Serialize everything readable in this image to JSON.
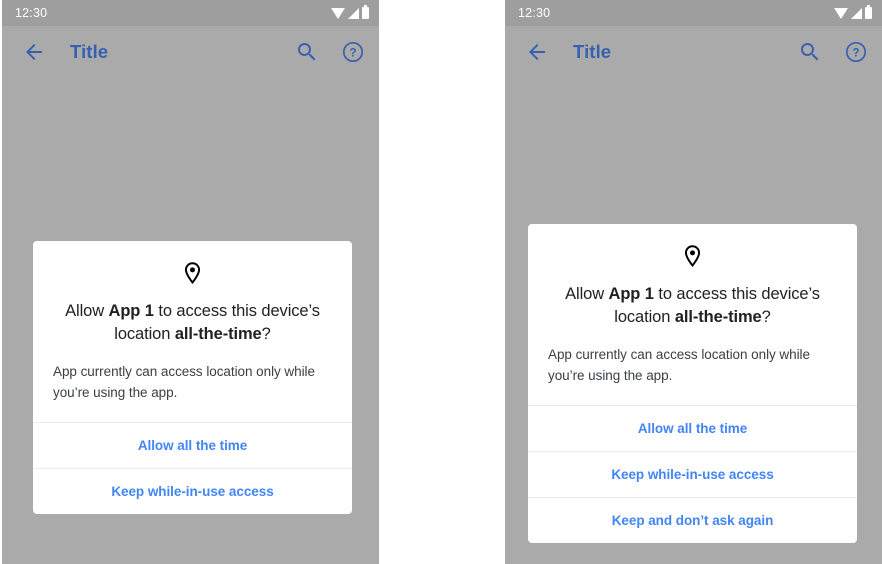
{
  "colors": {
    "screen_background": "#aaaaaa",
    "status_bar_background": "#9e9e9e",
    "toolbar_title": "#3860b0",
    "dialog_background": "#ffffff",
    "action_link": "#4285f4",
    "headline_text": "#202124",
    "body_text": "#3c4043",
    "divider": "#e8eaed"
  },
  "phones": [
    {
      "id": "phone-1",
      "status_bar": {
        "time": "12:30",
        "icons": [
          "wifi-icon",
          "signal-icon",
          "battery-icon"
        ]
      },
      "toolbar": {
        "back_icon": "back-arrow-icon",
        "title": "Title",
        "search_icon": "search-icon",
        "help_icon": "help-icon"
      },
      "dialog": {
        "icon": "location-pin-icon",
        "headline_part_1": "Allow ",
        "headline_bold_1": "App 1",
        "headline_part_2": " to access this device’s location ",
        "headline_bold_2": "all-the-time",
        "headline_part_3": "?",
        "body": "App currently can access location only while you’re using the app.",
        "actions": [
          {
            "label": "Allow all the time"
          },
          {
            "label": "Keep while-in-use access"
          }
        ]
      }
    },
    {
      "id": "phone-2",
      "status_bar": {
        "time": "12:30",
        "icons": [
          "wifi-icon",
          "signal-icon",
          "battery-icon"
        ]
      },
      "toolbar": {
        "back_icon": "back-arrow-icon",
        "title": "Title",
        "search_icon": "search-icon",
        "help_icon": "help-icon"
      },
      "dialog": {
        "icon": "location-pin-icon",
        "headline_part_1": "Allow ",
        "headline_bold_1": "App 1",
        "headline_part_2": " to access this device’s location ",
        "headline_bold_2": "all-the-time",
        "headline_part_3": "?",
        "body": "App currently can access location only while you’re using the app.",
        "actions": [
          {
            "label": "Allow all the time"
          },
          {
            "label": "Keep while-in-use access"
          },
          {
            "label": "Keep and don’t ask again"
          }
        ]
      }
    }
  ]
}
